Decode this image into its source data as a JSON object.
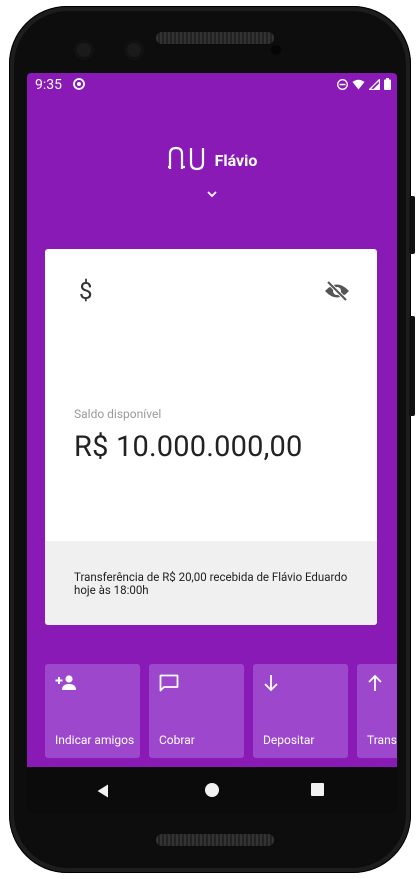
{
  "status_bar": {
    "time": "9:35",
    "left_icon": "at-icon",
    "right_icons": [
      "do-not-disturb-icon",
      "wifi-icon",
      "signal-icon",
      "battery-icon"
    ]
  },
  "header": {
    "logo": "nu",
    "user_name": "Flávio",
    "expand_icon": "chevron-down-icon"
  },
  "balance_card": {
    "icon": "dollar-icon",
    "hide_icon": "eye-off-icon",
    "label": "Saldo disponível",
    "amount": "R$ 10.000.000,00",
    "last_activity": "Transferência de R$ 20,00 recebida de Flávio Eduardo hoje às 18:00h"
  },
  "actions": [
    {
      "label": "Indicar amigos",
      "icon": "add-person-icon"
    },
    {
      "label": "Cobrar",
      "icon": "chat-icon"
    },
    {
      "label": "Depositar",
      "icon": "arrow-down-icon"
    },
    {
      "label": "Transferir",
      "icon": "arrow-up-icon"
    }
  ],
  "nav": [
    "back",
    "home",
    "recents"
  ],
  "colors": {
    "primary": "#8a1ab6",
    "action_tile": "#9c47cc",
    "card_bg": "#ffffff",
    "card_footer": "#f0f0f0"
  }
}
